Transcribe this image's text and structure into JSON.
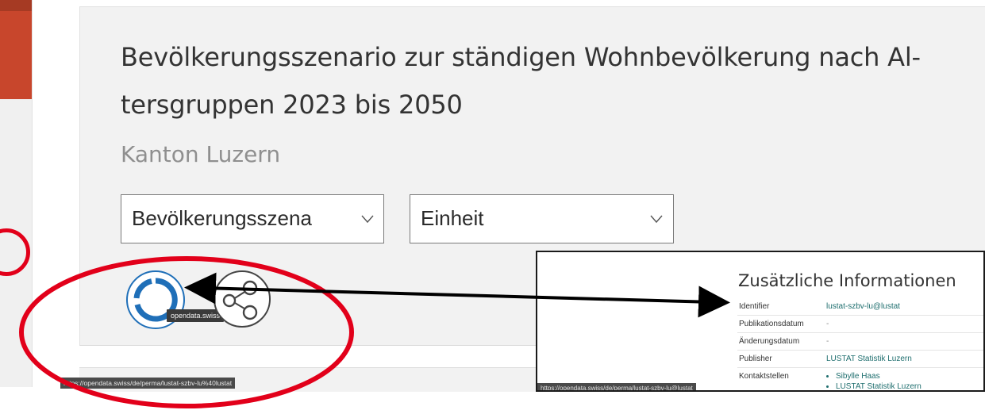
{
  "page": {
    "title": "Bevölkerungsszenario zur ständigen Wohnbevölkerung nach Al-tersgruppen 2023 bis 2050",
    "subtitle": "Kanton Luzern"
  },
  "filters": [
    {
      "label": "Bevölkerungsszena",
      "icon": "chevron-down-icon"
    },
    {
      "label": "Einheit",
      "icon": "chevron-down-icon"
    }
  ],
  "actions": {
    "opendata_tooltip": "opendata.swiss",
    "opendata_icon": "opendata-swiss-icon",
    "share_icon": "share-icon"
  },
  "status_bar_url": "https://opendata.swiss/de/perma/lustat-szbv-lu%40lustat",
  "info_panel": {
    "title": "Zusätzliche Informationen",
    "rows": [
      {
        "key": "Identifier",
        "value": "lustat-szbv-lu@lustat"
      },
      {
        "key": "Publikationsdatum",
        "value": "-"
      },
      {
        "key": "Änderungsdatum",
        "value": "-"
      },
      {
        "key": "Publisher",
        "value": "LUSTAT Statistik Luzern"
      },
      {
        "key": "Kontaktstellen",
        "contacts": [
          "Sibylle Haas",
          "LUSTAT Statistik Luzern"
        ]
      }
    ],
    "status_bar_url": "https://opendata.swiss/de/perma/lustat-szbv-lu@lustat"
  },
  "colors": {
    "annotation_red": "#e2001a",
    "opendata_blue": "#1f6fb8",
    "link_teal": "#1e6e6e"
  }
}
